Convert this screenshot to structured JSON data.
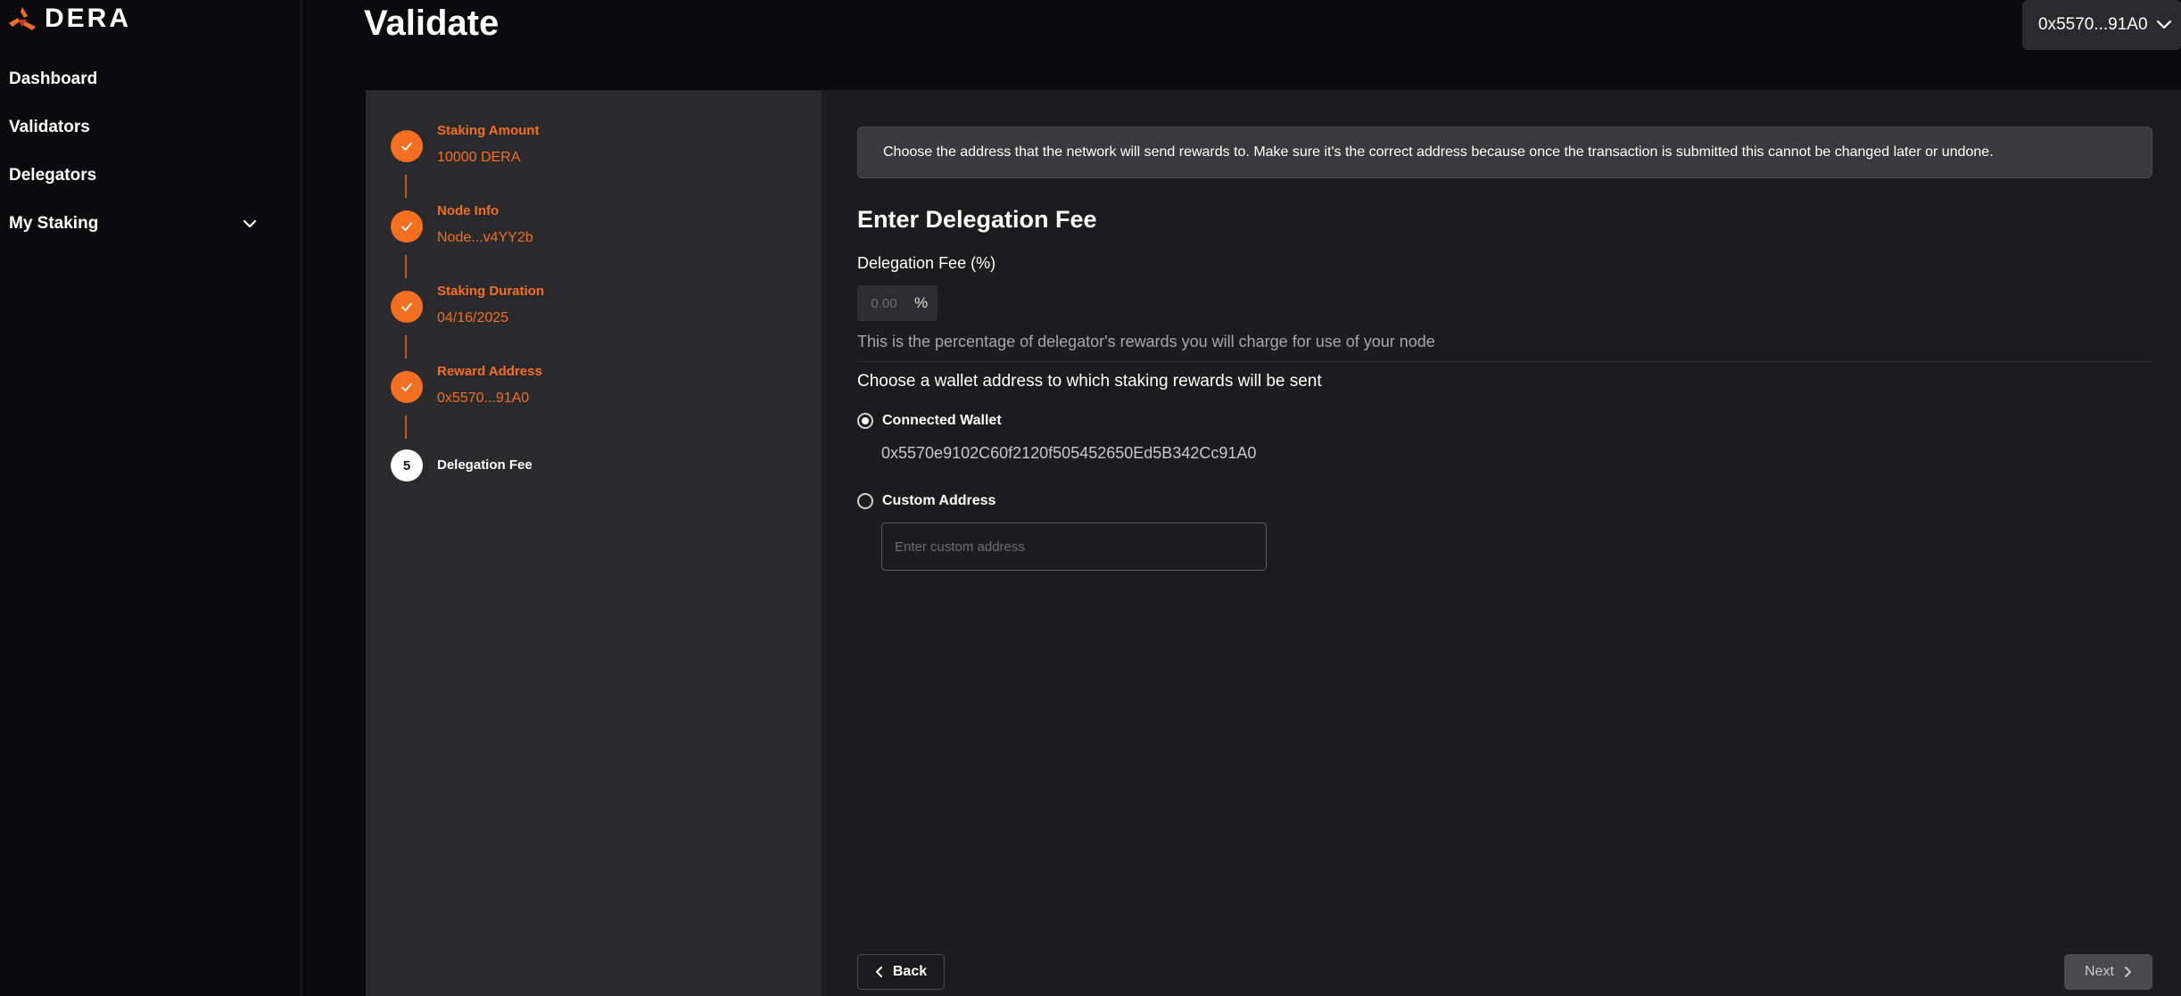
{
  "app": {
    "logo_text": "DERA"
  },
  "sidebar": {
    "items": [
      {
        "label": "Dashboard"
      },
      {
        "label": "Validators"
      },
      {
        "label": "Delegators"
      },
      {
        "label": "My Staking"
      }
    ]
  },
  "header": {
    "title": "Validate",
    "wallet": "0x5570...91A0"
  },
  "steps": [
    {
      "number": "1",
      "title": "Staking Amount",
      "value": "10000 DERA",
      "status": "complete"
    },
    {
      "number": "2",
      "title": "Node Info",
      "value": "Node...v4YY2b",
      "status": "complete"
    },
    {
      "number": "3",
      "title": "Staking Duration",
      "value": "04/16/2025",
      "status": "complete"
    },
    {
      "number": "4",
      "title": "Reward Address",
      "value": "0x5570...91A0",
      "status": "complete"
    },
    {
      "number": "5",
      "title": "Delegation Fee",
      "value": "",
      "status": "current"
    }
  ],
  "form": {
    "notice": "Choose the address that the network will send rewards to. Make sure it's the correct address because once the transaction is submitted this cannot be changed later or undone.",
    "heading": "Enter Delegation Fee",
    "fee_label": "Delegation Fee (%)",
    "fee_value": "",
    "fee_placeholder": "0.00",
    "fee_unit": "%",
    "fee_help": "This is the percentage of delegator's rewards you will charge for use of your node",
    "wallet_choice_label": "Choose a wallet address to which staking rewards will be sent",
    "connected_wallet_label": "Connected Wallet",
    "connected_wallet_address": "0x5570e9102C60f2120f505452650Ed5B342Cc91A0",
    "custom_address_label": "Custom Address",
    "custom_address_placeholder": "Enter custom address",
    "selected_option": "connected"
  },
  "buttons": {
    "back": "Back",
    "next": "Next"
  },
  "colors": {
    "accent": "#f26f21",
    "background": "#0b0b0d",
    "panel": "#2a2a2d",
    "form_bg": "#1c1c1e"
  }
}
